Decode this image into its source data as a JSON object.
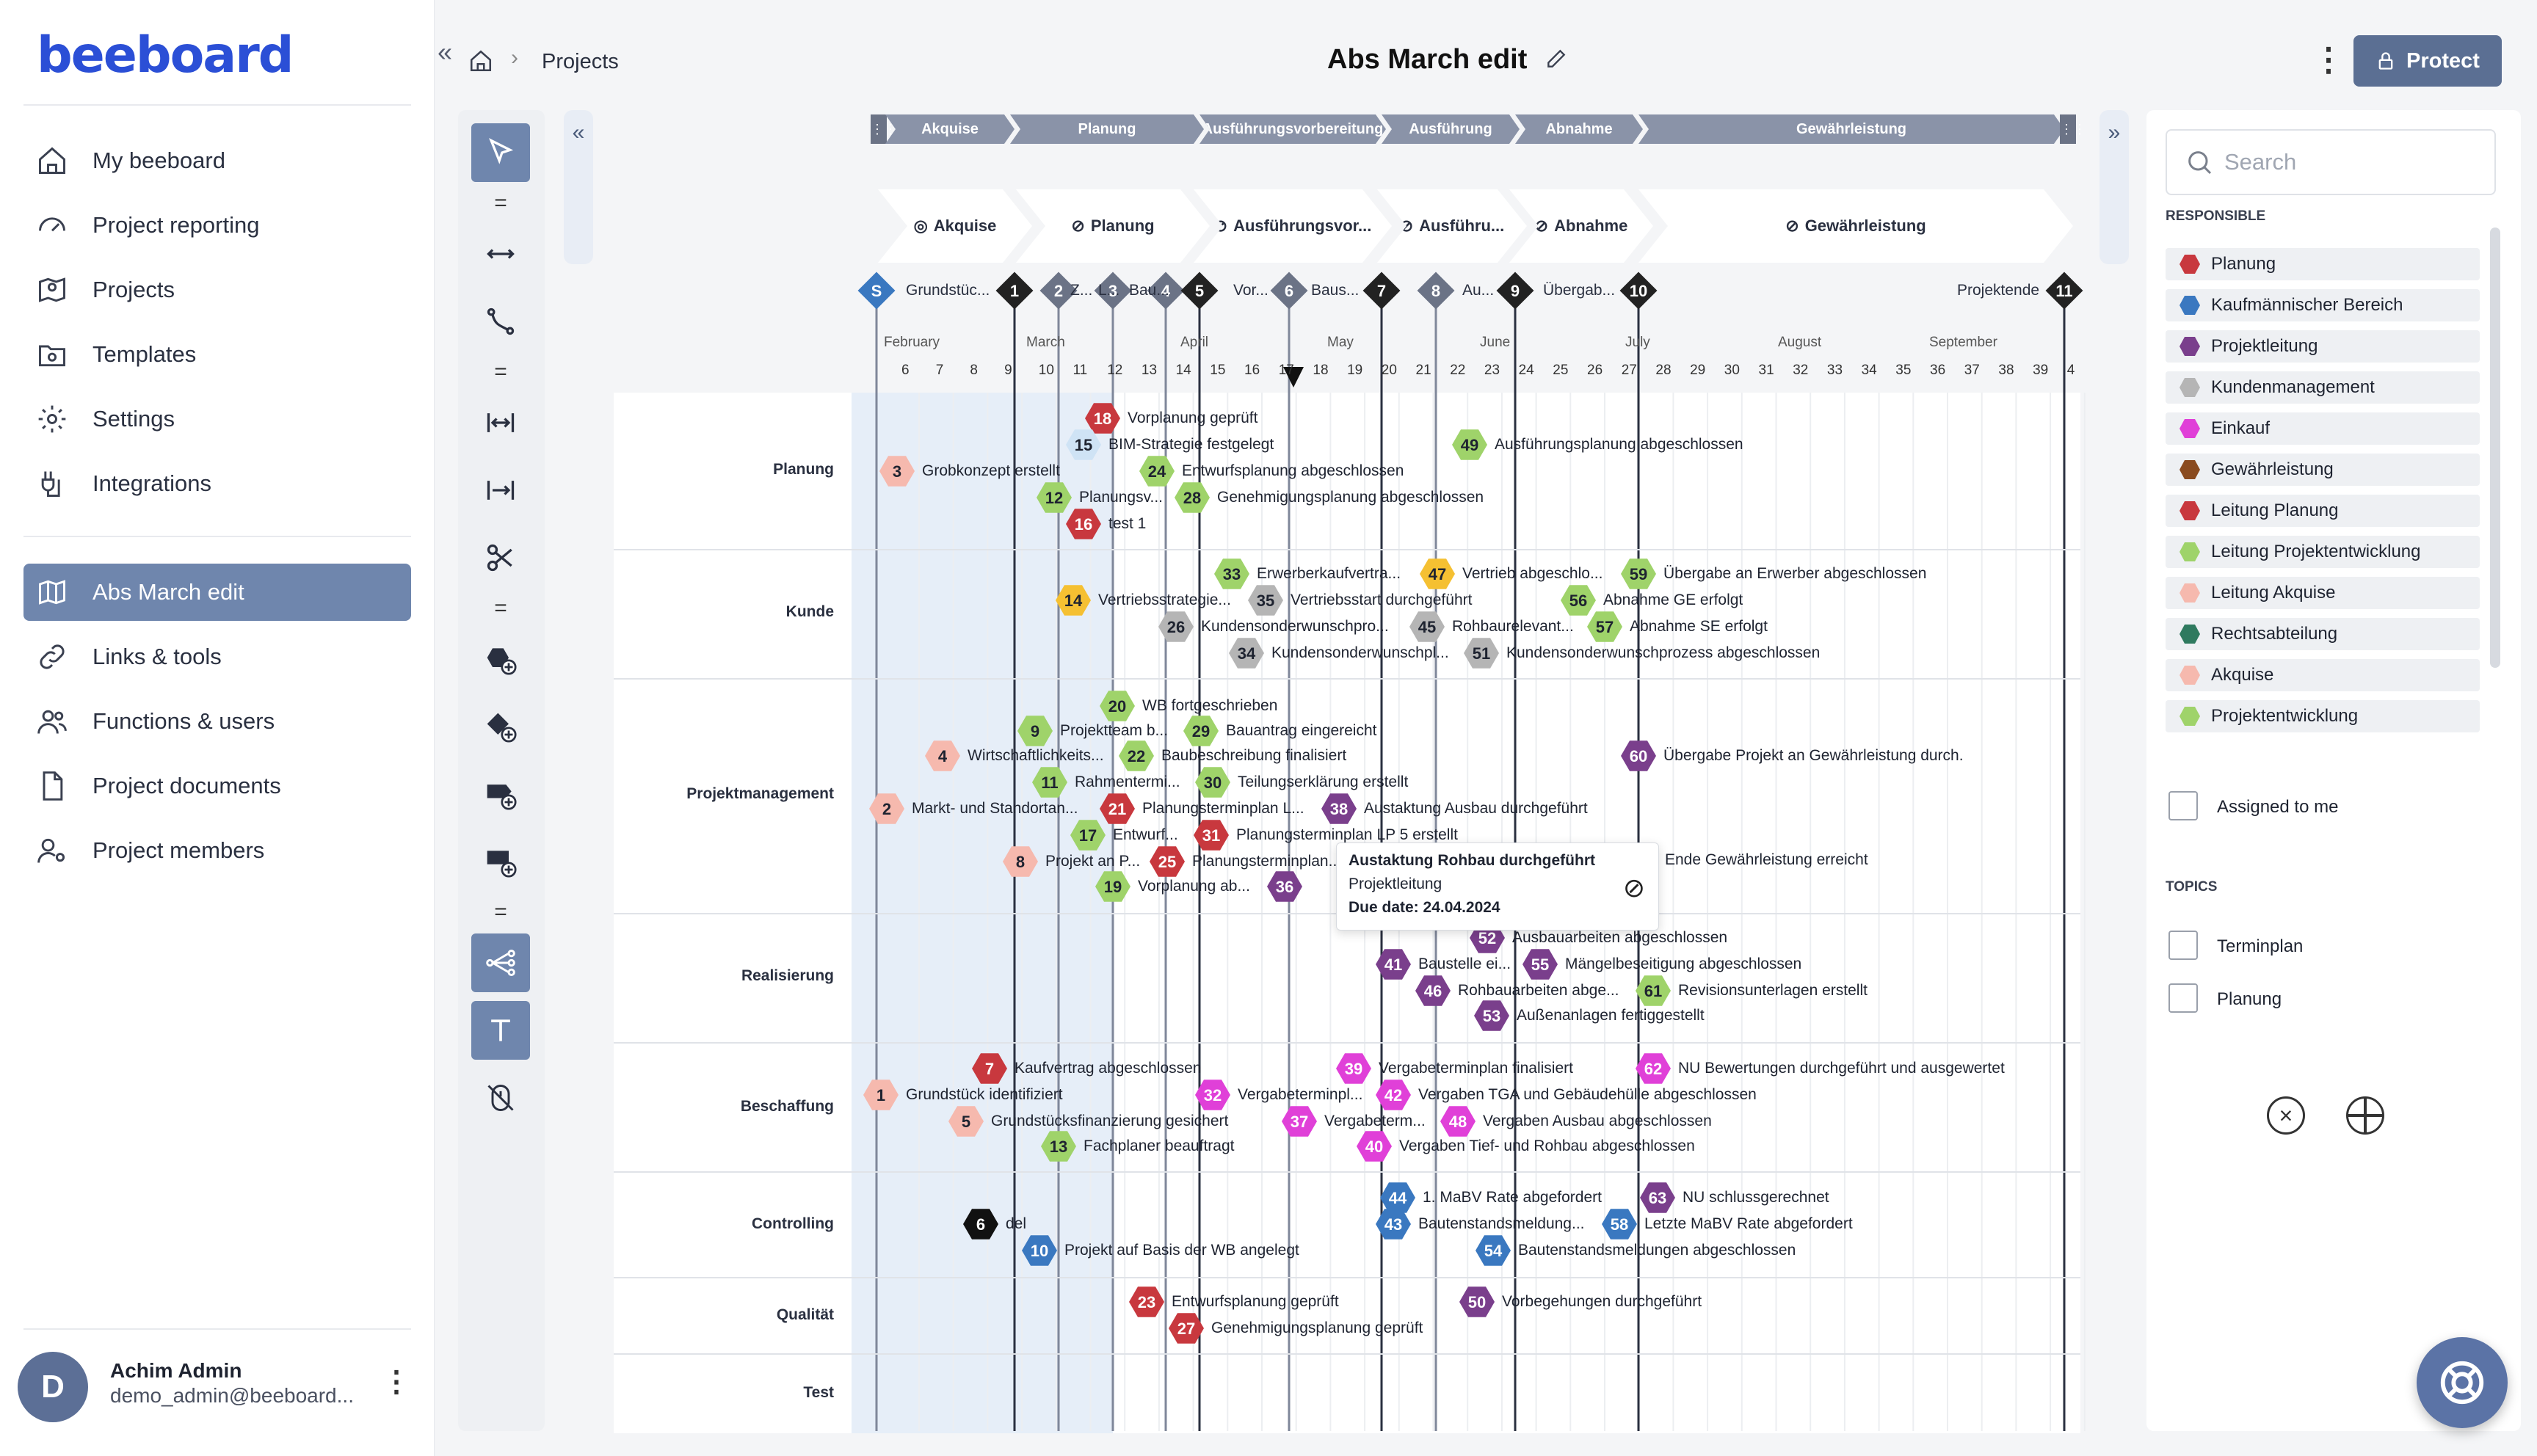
{
  "app": {
    "logo": "beeboard"
  },
  "nav": {
    "items": [
      {
        "label": "My beeboard",
        "icon": "home-icon"
      },
      {
        "label": "Project reporting",
        "icon": "gauge-icon"
      },
      {
        "label": "Projects",
        "icon": "map-pin-icon"
      },
      {
        "label": "Templates",
        "icon": "folder-template-icon"
      },
      {
        "label": "Settings",
        "icon": "gear-icon"
      },
      {
        "label": "Integrations",
        "icon": "plug-icon"
      }
    ],
    "project_items": [
      {
        "label": "Abs March edit",
        "icon": "map-icon"
      },
      {
        "label": "Links & tools",
        "icon": "link-icon"
      },
      {
        "label": "Functions & users",
        "icon": "users-icon"
      },
      {
        "label": "Project documents",
        "icon": "document-icon"
      },
      {
        "label": "Project members",
        "icon": "user-gear-icon"
      }
    ]
  },
  "user": {
    "initial": "D",
    "name": "Achim Admin",
    "email": "demo_admin@beeboard..."
  },
  "header": {
    "breadcrumb": "Projects",
    "title": "Abs March edit",
    "protect_label": "Protect"
  },
  "phases_top": [
    "Akquise",
    "Planung",
    "Ausführungsvorbereitung",
    "Ausführung",
    "Abnahme",
    "Gewährleistung"
  ],
  "phases": [
    "Akquise",
    "Planung",
    "Ausführungsvor...",
    "Ausführu...",
    "Abnahme",
    "Gewährleistung"
  ],
  "milestones": [
    {
      "id": "S",
      "label": "Grundstüc..."
    },
    {
      "id": "1",
      "label": ""
    },
    {
      "id": "2",
      "label": "Z..."
    },
    {
      "id": "3",
      "label": "L..."
    },
    {
      "id": "4",
      "label": "Bau..."
    },
    {
      "id": "5",
      "label": "Vor..."
    },
    {
      "id": "6",
      "label": "Baus..."
    },
    {
      "id": "7",
      "label": ""
    },
    {
      "id": "8",
      "label": "Au..."
    },
    {
      "id": "9",
      "label": "Übergab..."
    },
    {
      "id": "10",
      "label": ""
    },
    {
      "id": "11",
      "label": "Projektende"
    }
  ],
  "months": [
    "February",
    "March",
    "April",
    "May",
    "June",
    "July",
    "August",
    "September"
  ],
  "weeks": [
    "6",
    "7",
    "8",
    "9",
    "10",
    "11",
    "12",
    "13",
    "14",
    "15",
    "16",
    "17",
    "18",
    "19",
    "20",
    "21",
    "22",
    "23",
    "24",
    "25",
    "26",
    "27",
    "28",
    "29",
    "30",
    "31",
    "32",
    "33",
    "34",
    "35",
    "36",
    "37",
    "38",
    "39",
    "4"
  ],
  "rows": [
    "Planung",
    "Kunde",
    "Projektmanagement",
    "Realisierung",
    "Beschaffung",
    "Controlling",
    "Qualität",
    "Test"
  ],
  "tasks": [
    {
      "n": "18",
      "label": "Vorplanung geprüft",
      "color": "#c8383e"
    },
    {
      "n": "15",
      "label": "BIM-Strategie festgelegt",
      "color": "#cfe3f5"
    },
    {
      "n": "3",
      "label": "Grobkonzept erstellt",
      "color": "#f6b9ae"
    },
    {
      "n": "24",
      "label": "Entwurfsplanung abgeschlossen",
      "color": "#9fd36a"
    },
    {
      "n": "12",
      "label": "Planungsv...",
      "color": "#9fd36a"
    },
    {
      "n": "28",
      "label": "Genehmigungsplanung abgeschlossen",
      "color": "#9fd36a"
    },
    {
      "n": "16",
      "label": "test 1",
      "color": "#c8383e"
    },
    {
      "n": "49",
      "label": "Ausführungsplanung abgeschlossen",
      "color": "#9fd36a"
    },
    {
      "n": "33",
      "label": "Erwerberkaufvertra...",
      "color": "#9fd36a"
    },
    {
      "n": "47",
      "label": "Vertrieb abgeschlo...",
      "color": "#f5c032"
    },
    {
      "n": "59",
      "label": "Übergabe an Erwerber abgeschlossen",
      "color": "#9fd36a"
    },
    {
      "n": "14",
      "label": "Vertriebsstrategie...",
      "color": "#f5c032"
    },
    {
      "n": "35",
      "label": "Vertriebsstart durchgeführt",
      "color": "#b5b5b5"
    },
    {
      "n": "56",
      "label": "Abnahme GE erfolgt",
      "color": "#9fd36a"
    },
    {
      "n": "26",
      "label": "Kundensonderwunschpro...",
      "color": "#b5b5b5"
    },
    {
      "n": "45",
      "label": "Rohbaurelevant...",
      "color": "#b5b5b5"
    },
    {
      "n": "57",
      "label": "Abnahme SE erfolgt",
      "color": "#9fd36a"
    },
    {
      "n": "34",
      "label": "Kundensonderwunschpl...",
      "color": "#b5b5b5"
    },
    {
      "n": "51",
      "label": "Kundensonderwunschprozess abgeschlossen",
      "color": "#b5b5b5"
    },
    {
      "n": "20",
      "label": "WB fortgeschrieben",
      "color": "#9fd36a"
    },
    {
      "n": "9",
      "label": "Projektteam b...",
      "color": "#9fd36a"
    },
    {
      "n": "29",
      "label": "Bauantrag eingereicht",
      "color": "#9fd36a"
    },
    {
      "n": "4",
      "label": "Wirtschaftlichkeits...",
      "color": "#f6b9ae"
    },
    {
      "n": "22",
      "label": "Baubeschreibung finalisiert",
      "color": "#9fd36a"
    },
    {
      "n": "60",
      "label": "Übergabe Projekt an Gewährleistung durch.",
      "color": "#7a3f8c"
    },
    {
      "n": "11",
      "label": "Rahmentermi...",
      "color": "#9fd36a"
    },
    {
      "n": "30",
      "label": "Teilungserklärung erstellt",
      "color": "#9fd36a"
    },
    {
      "n": "2",
      "label": "Markt- und Standortan...",
      "color": "#f6b9ae"
    },
    {
      "n": "21",
      "label": "Planungsterminplan L...",
      "color": "#c8383e"
    },
    {
      "n": "38",
      "label": "Austaktung Ausbau durchgeführt",
      "color": "#7a3f8c"
    },
    {
      "n": "17",
      "label": "Entwurf...",
      "color": "#9fd36a"
    },
    {
      "n": "31",
      "label": "Planungsterminplan LP 5 erstellt",
      "color": "#c8383e"
    },
    {
      "n": "8",
      "label": "Projekt an P...",
      "color": "#f6b9ae"
    },
    {
      "n": "25",
      "label": "Planungsterminplan...",
      "color": "#c8383e"
    },
    {
      "n": "19",
      "label": "Vorplanung ab...",
      "color": "#9fd36a"
    },
    {
      "n": "36",
      "label": "",
      "color": "#7a3f8c"
    },
    {
      "n": "52",
      "label": "Ausbauarbeiten abgeschlossen",
      "color": "#7a3f8c"
    },
    {
      "n": "41",
      "label": "Baustelle ei...",
      "color": "#7a3f8c"
    },
    {
      "n": "55",
      "label": "Mängelbeseitigung abgeschlossen",
      "color": "#7a3f8c"
    },
    {
      "n": "46",
      "label": "Rohbauarbeiten abge...",
      "color": "#7a3f8c"
    },
    {
      "n": "61",
      "label": "Revisionsunterlagen erstellt",
      "color": "#9fd36a"
    },
    {
      "n": "53",
      "label": "Außenanlagen fertiggestellt",
      "color": "#7a3f8c"
    },
    {
      "n": "7",
      "label": "Kaufvertrag abgeschlossen",
      "color": "#c8383e"
    },
    {
      "n": "39",
      "label": "Vergabeterminplan finalisiert",
      "color": "#e040d8"
    },
    {
      "n": "62",
      "label": "NU Bewertungen durchgeführt und ausgewertet",
      "color": "#e040d8"
    },
    {
      "n": "1",
      "label": "Grundstück identifiziert",
      "color": "#f6b9ae"
    },
    {
      "n": "32",
      "label": "Vergabeterminpl...",
      "color": "#e040d8"
    },
    {
      "n": "42",
      "label": "Vergaben TGA und Gebäudehülle abgeschlossen",
      "color": "#e040d8"
    },
    {
      "n": "5",
      "label": "Grundstücksfinanzierung gesichert",
      "color": "#f6b9ae"
    },
    {
      "n": "37",
      "label": "Vergabeterm...",
      "color": "#e040d8"
    },
    {
      "n": "48",
      "label": "Vergaben Ausbau abgeschlossen",
      "color": "#e040d8"
    },
    {
      "n": "13",
      "label": "Fachplaner beauftragt",
      "color": "#9fd36a"
    },
    {
      "n": "40",
      "label": "Vergaben Tief- und Rohbau abgeschlossen",
      "color": "#e040d8"
    },
    {
      "n": "44",
      "label": "1. MaBV Rate abgefordert",
      "color": "#3a78c0"
    },
    {
      "n": "63",
      "label": "NU schlussgerechnet",
      "color": "#7a3f8c"
    },
    {
      "n": "6",
      "label": "del",
      "color": "#111111"
    },
    {
      "n": "43",
      "label": "Bautenstandsmeldung...",
      "color": "#3a78c0"
    },
    {
      "n": "58",
      "label": "Letzte MaBV Rate abgefordert",
      "color": "#3a78c0"
    },
    {
      "n": "10",
      "label": "Projekt auf Basis der WB angelegt",
      "color": "#3a78c0"
    },
    {
      "n": "54",
      "label": "Bautenstandsmeldungen abgeschlossen",
      "color": "#3a78c0"
    },
    {
      "n": "23",
      "label": "Entwurfsplanung geprüft",
      "color": "#c8383e"
    },
    {
      "n": "50",
      "label": "Vorbegehungen durchgeführt",
      "color": "#7a3f8c"
    },
    {
      "n": "27",
      "label": "Genehmigungsplanung geprüft",
      "color": "#c8383e"
    }
  ],
  "tooltip": {
    "title": "Austaktung Rohbau durchgeführt",
    "role": "Projektleitung",
    "due": "Due date: 24.04.2024"
  },
  "extra_label": "Ende Gewährleistung erreicht",
  "right_panel": {
    "search_placeholder": "Search",
    "responsible_heading": "RESPONSIBLE",
    "responsible": [
      {
        "label": "Planung",
        "color": "#c8383e"
      },
      {
        "label": "Kaufmännischer Bereich",
        "color": "#3a78c0"
      },
      {
        "label": "Projektleitung",
        "color": "#7a3f8c"
      },
      {
        "label": "Kundenmanagement",
        "color": "#b5b5b5"
      },
      {
        "label": "Einkauf",
        "color": "#e040d8"
      },
      {
        "label": "Gewährleistung",
        "color": "#8a4b1f"
      },
      {
        "label": "Leitung Planung",
        "color": "#c8383e"
      },
      {
        "label": "Leitung Projektentwicklung",
        "color": "#9fd36a"
      },
      {
        "label": "Leitung Akquise",
        "color": "#f6b9ae"
      },
      {
        "label": "Rechtsabteilung",
        "color": "#2f7a5f"
      },
      {
        "label": "Akquise",
        "color": "#f6b9ae"
      },
      {
        "label": "Projektentwicklung",
        "color": "#9fd36a"
      }
    ],
    "assigned_label": "Assigned to me",
    "topics_heading": "TOPICS",
    "topics": [
      "Terminplan",
      "Planung"
    ]
  }
}
